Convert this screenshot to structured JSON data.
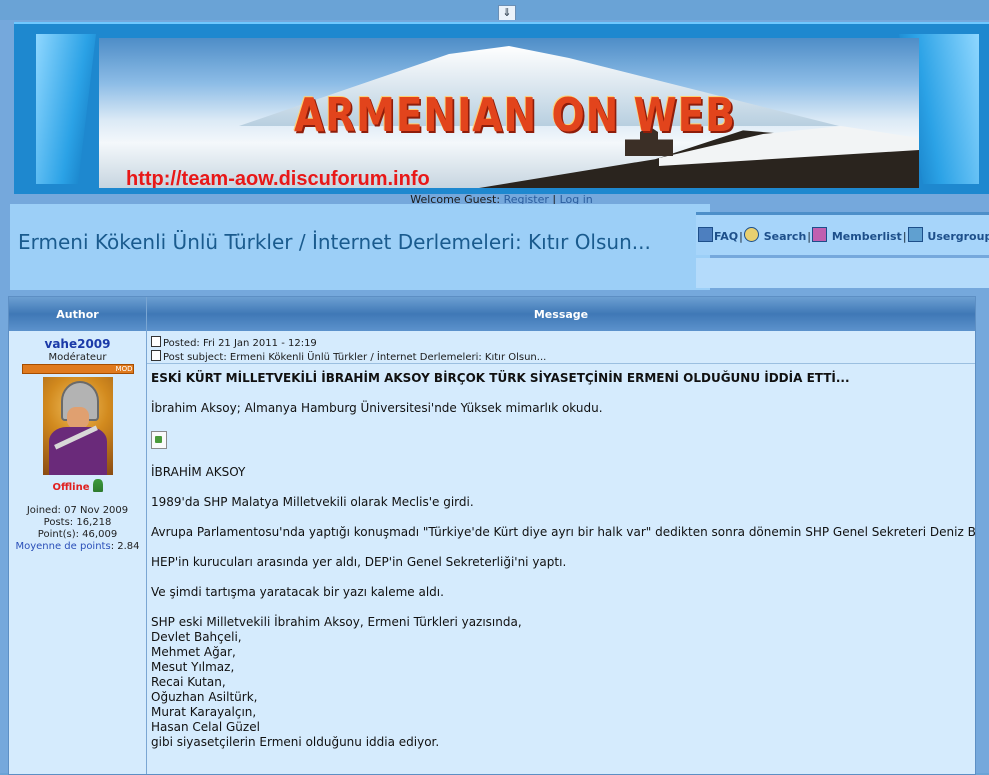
{
  "top": {
    "arrow_glyph": "⇓"
  },
  "banner": {
    "logo_text": "ARMENIAN ON WEB",
    "url_text": "http://team-aow.discuforum.info"
  },
  "welcome": {
    "prefix": "Welcome Guest: ",
    "register": "Register",
    "separator": " | ",
    "login": "Log in"
  },
  "page_title": "Ermeni Kökenli Ünlü Türkler / İnternet Derlemeleri: Kıtır Olsun...",
  "nav": {
    "items": [
      {
        "label": "FAQ",
        "icon": "faq-icon"
      },
      {
        "label": "Search",
        "icon": "search-icon"
      },
      {
        "label": "Memberlist",
        "icon": "memberlist-icon"
      },
      {
        "label": "Usergroups",
        "icon": "usergroups-icon"
      }
    ],
    "separator": "|"
  },
  "table": {
    "author_header": "Author",
    "message_header": "Message"
  },
  "author": {
    "username": "vahe2009",
    "rank": "Modérateur",
    "rank_badge": "MOD",
    "status": "Offline",
    "joined": "Joined: 07 Nov 2009",
    "posts": "Posts: 16,218",
    "points": "Point(s): 46,009",
    "moyenne_label": "Moyenne de points",
    "moyenne_value": ": 2.84"
  },
  "post": {
    "posted": "Posted: Fri 21 Jan 2011 - 12:19",
    "subject": "Post subject: Ermeni Kökenli Ünlü Türkler / İnternet Derlemeleri: Kıtır Olsun...",
    "headline": "ESKİ KÜRT MİLLETVEKİLİ İBRAHİM AKSOY BİRÇOK TÜRK SİYASETÇİNİN ERMENİ OLDUĞUNU İDDİA ETTİ...",
    "p1": "İbrahim Aksoy; Almanya Hamburg Üniversitesi'nde Yüksek mimarlık okudu.",
    "p2": "İBRAHİM AKSOY",
    "p3": "1989'da SHP Malatya Milletvekili olarak Meclis'e girdi.",
    "p4": "Avrupa Parlamentosu'nda yaptığı konuşmadı \"Türkiye'de Kürt diye ayrı bir halk var\" dedikten sonra dönemin SHP Genel Sekreteri Deniz Ba",
    "p5": "HEP'in kurucuları arasında yer aldı, DEP'in Genel Sekreterliği'ni yaptı.",
    "p6": "Ve şimdi tartışma yaratacak bir yazı kaleme aldı.",
    "p7": "SHP eski Milletvekili İbrahim Aksoy, Ermeni Türkleri yazısında,",
    "names": [
      "Devlet Bahçeli,",
      "Mehmet Ağar,",
      "Mesut Yılmaz,",
      "Recai Kutan,",
      "Oğuzhan Asiltürk,",
      "Murat Karayalçın,",
      "Hasan Celal Güzel"
    ],
    "closing": "gibi siyasetçilerin Ermeni olduğunu iddia ediyor."
  }
}
